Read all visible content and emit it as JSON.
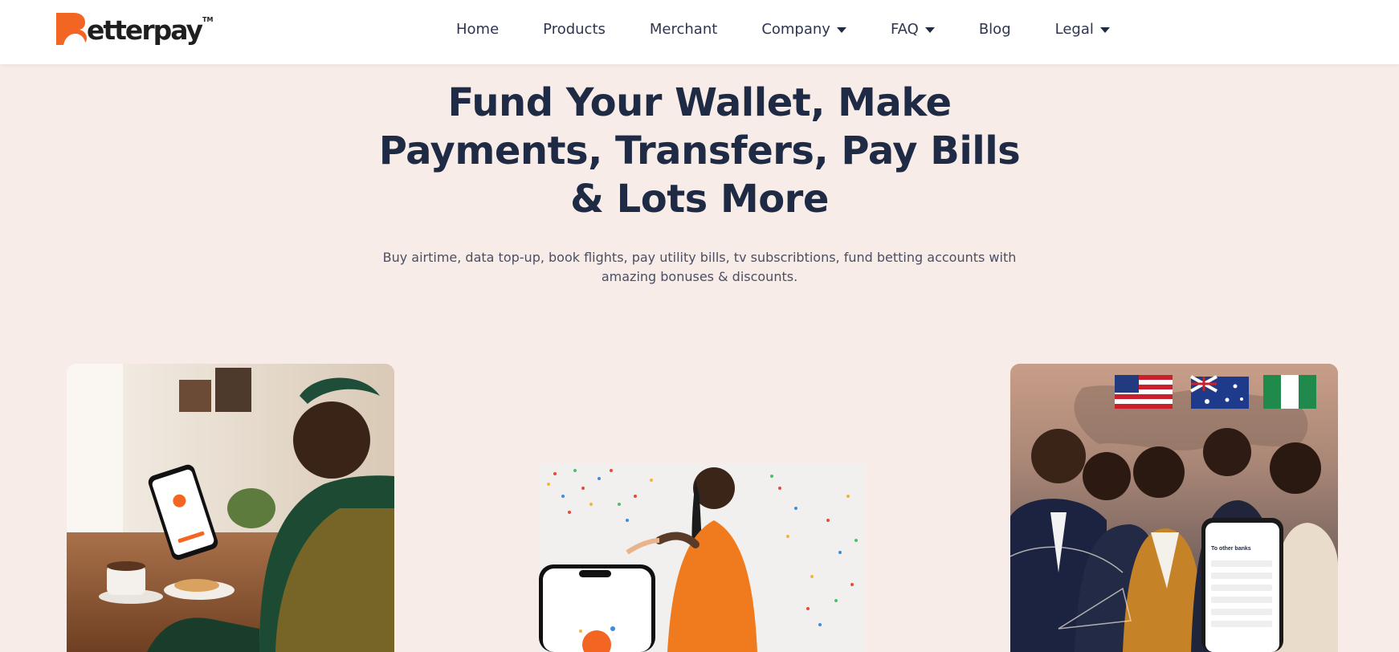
{
  "brand": {
    "name": "etterpay",
    "trademark": "TM",
    "accent": "#f26522",
    "dark": "#1f2a44",
    "background": "#f7ece8"
  },
  "nav": {
    "items": [
      {
        "label": "Home",
        "dropdown": false
      },
      {
        "label": "Products",
        "dropdown": false
      },
      {
        "label": "Merchant",
        "dropdown": false
      },
      {
        "label": "Company",
        "dropdown": true
      },
      {
        "label": "FAQ",
        "dropdown": true
      },
      {
        "label": "Blog",
        "dropdown": false
      },
      {
        "label": "Legal",
        "dropdown": true
      }
    ]
  },
  "hero": {
    "title_line1": "Fund Your Wallet, Make",
    "title_line2": "Payments, Transfers, Pay Bills",
    "title_line3": "& Lots More",
    "subtitle_line1": "Buy airtime, data top-up, book flights, pay utility bills, tv subscribtions, fund betting accounts with",
    "subtitle_line2": "amazing bonuses & discounts."
  },
  "cards": {
    "left": {
      "icon": "woman-with-phone-image"
    },
    "middle": {
      "icon": "celebration-shopping-image"
    },
    "right": {
      "icon": "business-team-transfer-image",
      "phone_heading": "To other banks"
    }
  }
}
